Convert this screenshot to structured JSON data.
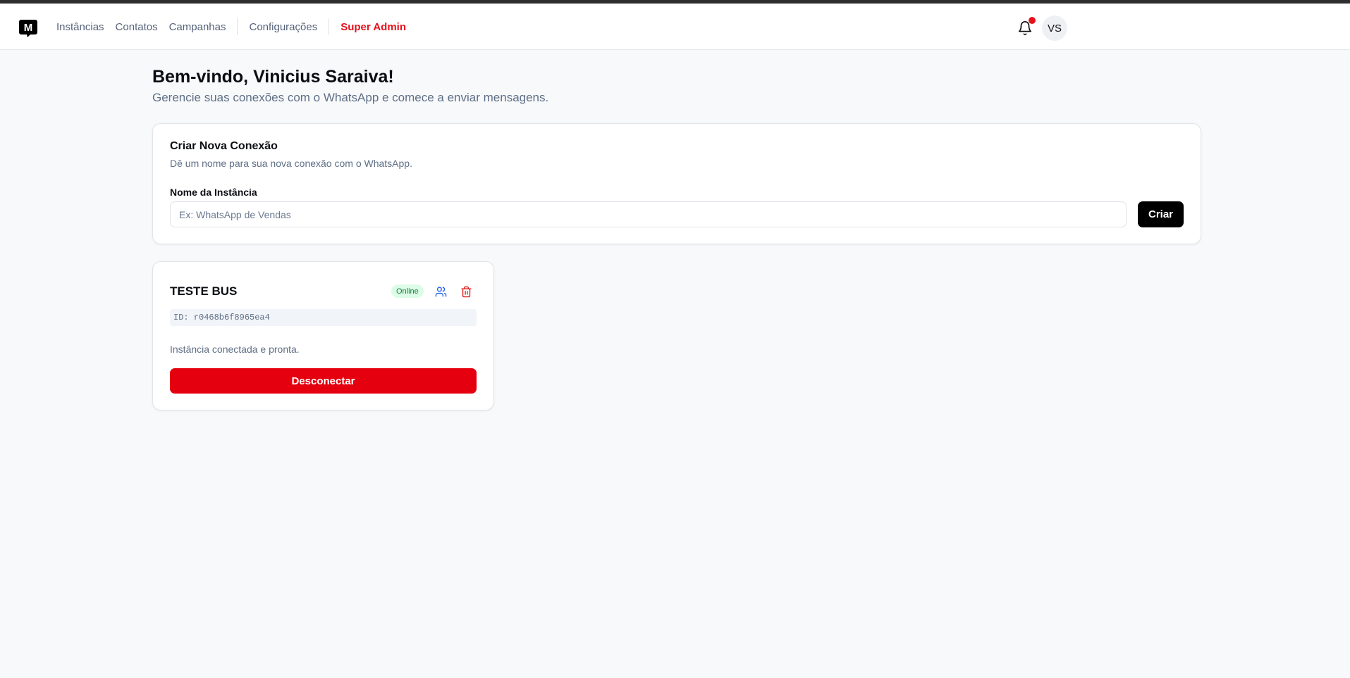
{
  "colors": {
    "accent_red": "#e5131d",
    "primary_black": "#000000",
    "success_bg": "#dcfce7",
    "success_text": "#15803d",
    "danger_button": "#e5000f",
    "muted_text": "#5f6f86"
  },
  "nav": {
    "logo_icon": "m-chat-bubble-icon",
    "logo_letter": "M",
    "links": [
      {
        "label": "Instâncias"
      },
      {
        "label": "Contatos"
      },
      {
        "label": "Campanhas"
      },
      {
        "label": "Configurações"
      },
      {
        "label": "Super Admin"
      }
    ],
    "notification_icon": "bell-icon",
    "has_unread_notifications": true,
    "avatar_initials": "VS"
  },
  "welcome": {
    "title": "Bem-vindo, Vinicius Saraiva!",
    "subtitle": "Gerencie suas conexões com o WhatsApp e comece a enviar mensagens."
  },
  "create_connection": {
    "title": "Criar Nova Conexão",
    "description": "Dê um nome para sua nova conexão com o WhatsApp.",
    "field_label": "Nome da Instância",
    "input_value": "",
    "input_placeholder": "Ex: WhatsApp de Vendas",
    "submit_label": "Criar"
  },
  "instances": [
    {
      "name": "TESTE BUS",
      "status": "Online",
      "id_text": "ID: r0468b6f8965ea4",
      "status_message": "Instância conectada e pronta.",
      "action_label": "Desconectar",
      "users_icon": "users-icon",
      "delete_icon": "trash-icon"
    }
  ]
}
